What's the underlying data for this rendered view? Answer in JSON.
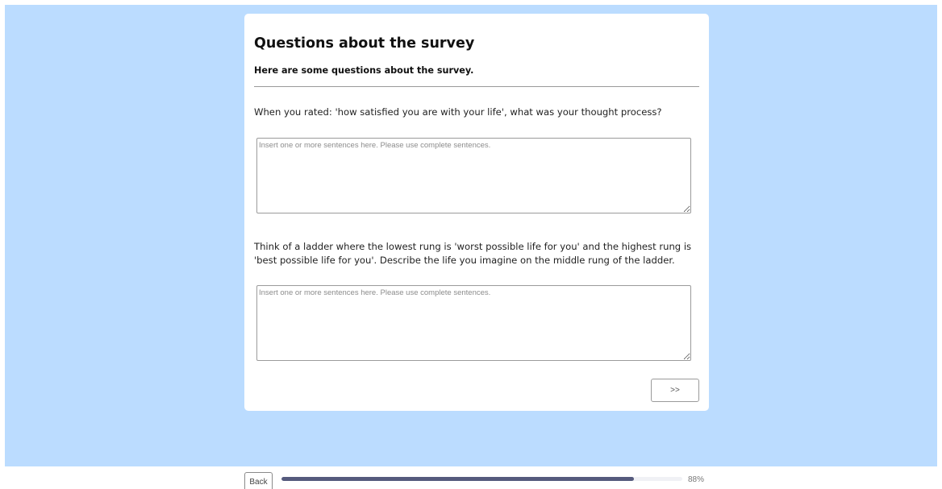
{
  "survey": {
    "title": "Questions about the survey",
    "subtitle": "Here are some questions about the survey.",
    "questions": [
      {
        "text": "When you rated: 'how satisfied you are with your life', what was your thought process?",
        "answer_value": "",
        "answer_placeholder": "Insert one or more sentences here. Please use complete sentences."
      },
      {
        "text": "Think of a ladder where the lowest rung is 'worst possible life for you' and the highest rung is 'best possible life for you'. Describe the life you imagine on the middle rung of the ladder.",
        "answer_value": "",
        "answer_placeholder": "Insert one or more sentences here. Please use complete sentences."
      }
    ],
    "next_label": ">>"
  },
  "footer": {
    "back_label": "Back",
    "progress_value": 0.88,
    "progress_label": "88%"
  },
  "colors": {
    "page_background": "#bbdcff",
    "card_background": "#ffffff",
    "progress_fill": "#555a7d",
    "progress_track": "#f0f1f5"
  }
}
